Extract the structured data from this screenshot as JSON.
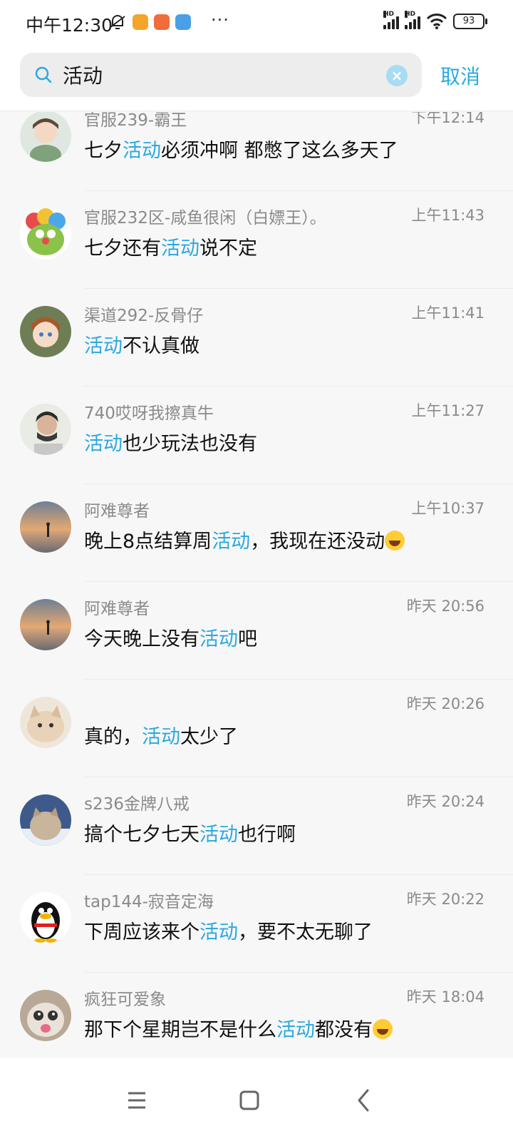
{
  "status_bar": {
    "time": "中午12:30",
    "dots": "···",
    "hd_label": "HD",
    "battery": "93"
  },
  "search": {
    "value": "活动",
    "clear_label": "×",
    "cancel_label": "取消"
  },
  "messages": [
    {
      "name": "官服239-霸王",
      "time": "下午12:14",
      "parts": [
        "七夕",
        "活动",
        "必须冲啊  都憋了这么多天了"
      ],
      "emoji": false
    },
    {
      "name": "官服232区-咸鱼很闲（白嫖王）。",
      "time": "上午11:43",
      "parts": [
        "七夕还有",
        "活动",
        "说不定"
      ],
      "emoji": false
    },
    {
      "name": "渠道292-反骨仔",
      "time": "上午11:41",
      "parts": [
        "",
        "活动",
        "不认真做"
      ],
      "emoji": false
    },
    {
      "name": "740哎呀我擦真牛",
      "time": "上午11:27",
      "parts": [
        "",
        "活动",
        "也少玩法也没有"
      ],
      "emoji": false
    },
    {
      "name": "阿难尊者",
      "time": "上午10:37",
      "parts": [
        "晚上8点结算周",
        "活动",
        "，我现在还没动"
      ],
      "emoji": true
    },
    {
      "name": "阿难尊者",
      "time": "昨天 20:56",
      "parts": [
        "今天晚上没有",
        "活动",
        "吧"
      ],
      "emoji": false
    },
    {
      "name": "",
      "time": "昨天 20:26",
      "parts": [
        "真的，",
        "活动",
        "太少了"
      ],
      "emoji": false
    },
    {
      "name": "s236金牌八戒",
      "time": "昨天 20:24",
      "parts": [
        "搞个七夕七天",
        "活动",
        "也行啊"
      ],
      "emoji": false
    },
    {
      "name": "tap144-寂音定海",
      "time": "昨天 20:22",
      "parts": [
        "下周应该来个",
        "活动",
        "，要不太无聊了"
      ],
      "emoji": false
    },
    {
      "name": "疯狂可爱象",
      "time": "昨天 18:04",
      "parts": [
        "那下个星期岂不是什么",
        "活动",
        "都没有"
      ],
      "emoji": true
    }
  ],
  "colors": {
    "accent": "#2aa8e0",
    "secondary_text": "#8a8a8a"
  }
}
